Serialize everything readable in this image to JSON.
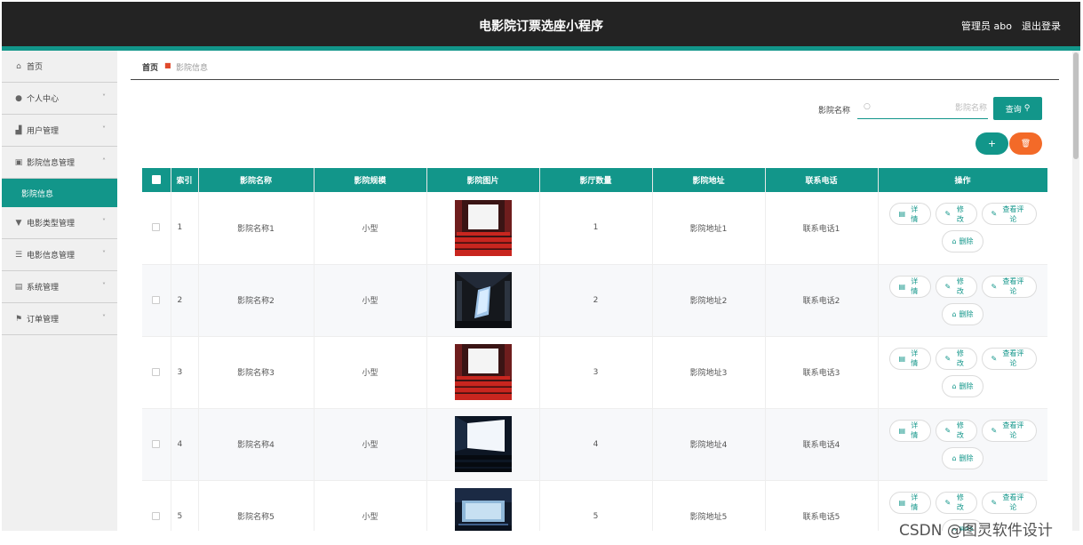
{
  "header": {
    "title": "电影院订票选座小程序",
    "admin_label": "管理员 abo",
    "logout_label": "退出登录"
  },
  "sidebar": {
    "items": [
      {
        "label": "首页",
        "icon": "home-icon",
        "chevron": false
      },
      {
        "label": "个人中心",
        "icon": "user-icon",
        "chevron": true
      },
      {
        "label": "用户管理",
        "icon": "users-icon",
        "chevron": true
      },
      {
        "label": "影院信息管理",
        "icon": "cinema-icon",
        "chevron": true,
        "expanded": true,
        "children": [
          "影院信息"
        ]
      },
      {
        "label": "电影类型管理",
        "icon": "tag-icon",
        "chevron": true
      },
      {
        "label": "电影信息管理",
        "icon": "sliders-icon",
        "chevron": true
      },
      {
        "label": "系统管理",
        "icon": "clipboard-icon",
        "chevron": true
      },
      {
        "label": "订单管理",
        "icon": "flag-icon",
        "chevron": true
      }
    ]
  },
  "breadcrumb": {
    "home": "首页",
    "current": "影院信息"
  },
  "search": {
    "label": "影院名称",
    "placeholder": "影院名称",
    "button_label": "查询"
  },
  "actions": {
    "add_label": "+",
    "delete_icon": "trash-icon"
  },
  "table": {
    "columns": [
      "索引",
      "影院名称",
      "影院规模",
      "影院图片",
      "影厅数量",
      "影院地址",
      "联系电话",
      "操作"
    ],
    "rows": [
      {
        "index": "1",
        "name": "影院名称1",
        "scale": "小型",
        "halls": "1",
        "address": "影院地址1",
        "phone": "联系电话1",
        "image": "red-theater"
      },
      {
        "index": "2",
        "name": "影院名称2",
        "scale": "小型",
        "halls": "2",
        "address": "影院地址2",
        "phone": "联系电话2",
        "image": "dark-hall"
      },
      {
        "index": "3",
        "name": "影院名称3",
        "scale": "小型",
        "halls": "3",
        "address": "影院地址3",
        "phone": "联系电话3",
        "image": "red-theater"
      },
      {
        "index": "4",
        "name": "影院名称4",
        "scale": "小型",
        "halls": "4",
        "address": "影院地址4",
        "phone": "联系电话4",
        "image": "blue-screen"
      },
      {
        "index": "5",
        "name": "影院名称5",
        "scale": "小型",
        "halls": "5",
        "address": "影院地址5",
        "phone": "联系电话5",
        "image": "stage-hall"
      }
    ],
    "op_labels": {
      "detail": "详情",
      "edit": "修改",
      "comments": "查看评论",
      "delete": "删除"
    }
  },
  "watermark": "CSDN @图灵软件设计"
}
